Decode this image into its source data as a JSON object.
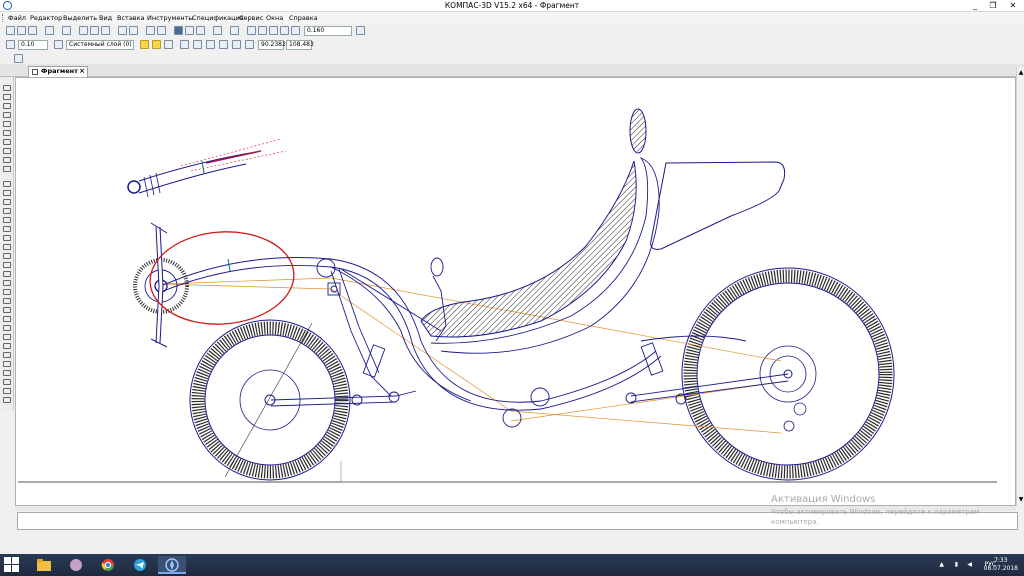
{
  "window": {
    "title": "КОМПАС-3D V15.2  x64 - Фрагмент",
    "minimize": "_",
    "restore": "❐",
    "close": "✕"
  },
  "menu": [
    "Файл",
    "Редактор",
    "Выделить",
    "Вид",
    "Вставка",
    "Инструменты",
    "Спецификация",
    "Сервис",
    "Окна",
    "Справка"
  ],
  "toolbar": {
    "scale_value": "0.160",
    "line_width": "0.10",
    "layer": "Системный слой (0)",
    "coord_x": "90.2382",
    "coord_y": "108.483"
  },
  "document_tab": {
    "label": "Фрагмент",
    "close": "×"
  },
  "activation": {
    "title": "Активация Windows",
    "message": "Чтобы активировать Windows, перейдите к параметрам компьютера."
  },
  "taskbar": {
    "tray_lang": "РУС",
    "clock_time": "7:33",
    "clock_date": "08.07.2018"
  },
  "colors": {
    "drawing": "#1a1a8c",
    "construction": "#e0902a",
    "highlight": "#d11a1a",
    "hatch": "#2a2a2a",
    "accent": "#1a8a8a"
  }
}
